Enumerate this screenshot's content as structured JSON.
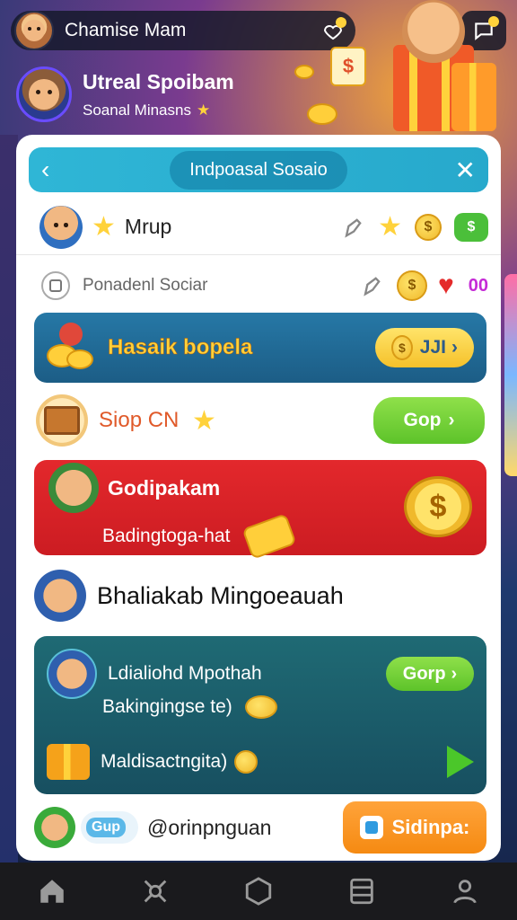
{
  "topbar": {
    "title": "Chamise Mam"
  },
  "profile": {
    "name": "Utreal Spoibam",
    "subtitle": "Soanal Minasns"
  },
  "card": {
    "header_title": "Indpoasal Sosaio",
    "row1_label": "Mrup",
    "row2_label": "Ponadenl Sociar",
    "row2_count": "00",
    "blue_tile": {
      "label": "Hasaik bopela",
      "button": "JJI"
    },
    "shop_row": {
      "label": "Siop CN",
      "button": "Gop"
    },
    "red_tile": {
      "title": "Godipakam",
      "subtitle": "Badingtoga-hat"
    },
    "plain_row": {
      "label": "Bhaliakab Mingoeauah"
    },
    "teal_tile": {
      "line1": "Ldialiohd Mpothah",
      "button": "Gorp",
      "line2": "Bakingingse te)",
      "line3": "Maldisactngita)"
    },
    "bottom_row": {
      "tag": "Gup",
      "label": "@orinpnguan",
      "button": "Sidinpa:"
    }
  },
  "colors": {
    "header": "#2fb6d6",
    "blue_tile": "#2678a6",
    "red_tile": "#e3282c",
    "teal_tile": "#1f6a74",
    "green_button": "#6fd03a",
    "orange_button": "#f58a12"
  },
  "nav": {
    "items": [
      "home-icon",
      "network-icon",
      "hexagon-icon",
      "list-icon",
      "profile-icon"
    ]
  }
}
